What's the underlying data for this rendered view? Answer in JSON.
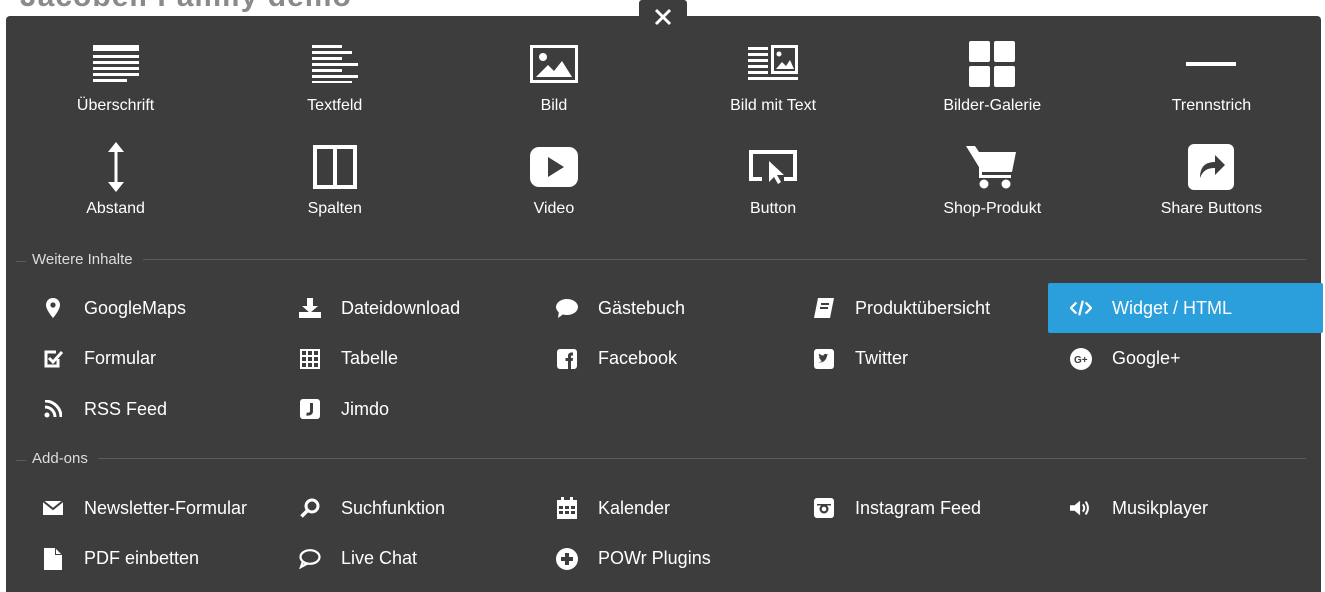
{
  "page": {
    "heading": "Jacobell Family demo"
  },
  "close": {
    "icon": "close-icon"
  },
  "tiles": [
    {
      "label": "Überschrift",
      "icon": "heading-icon"
    },
    {
      "label": "Textfeld",
      "icon": "text-icon"
    },
    {
      "label": "Bild",
      "icon": "image-icon"
    },
    {
      "label": "Bild mit Text",
      "icon": "image-text-icon"
    },
    {
      "label": "Bilder-Galerie",
      "icon": "gallery-icon"
    },
    {
      "label": "Trennstrich",
      "icon": "divider-icon"
    },
    {
      "label": "Abstand",
      "icon": "spacing-icon"
    },
    {
      "label": "Spalten",
      "icon": "columns-icon"
    },
    {
      "label": "Video",
      "icon": "video-icon"
    },
    {
      "label": "Button",
      "icon": "button-icon"
    },
    {
      "label": "Shop-Produkt",
      "icon": "cart-icon"
    },
    {
      "label": "Share Buttons",
      "icon": "share-icon"
    }
  ],
  "weitere": {
    "title": "Weitere Inhalte",
    "items": [
      {
        "label": "GoogleMaps",
        "icon": "map-pin-icon"
      },
      {
        "label": "Dateidownload",
        "icon": "download-icon"
      },
      {
        "label": "Gästebuch",
        "icon": "comment-icon"
      },
      {
        "label": "Produktübersicht",
        "icon": "product-list-icon"
      },
      {
        "label": "Widget / HTML",
        "icon": "code-icon",
        "active": true
      },
      {
        "label": "Formular",
        "icon": "checkbox-icon"
      },
      {
        "label": "Tabelle",
        "icon": "table-icon"
      },
      {
        "label": "Facebook",
        "icon": "facebook-icon"
      },
      {
        "label": "Twitter",
        "icon": "twitter-icon"
      },
      {
        "label": "Google+",
        "icon": "google-plus-icon"
      },
      {
        "label": "RSS Feed",
        "icon": "rss-icon"
      },
      {
        "label": "Jimdo",
        "icon": "jimdo-icon"
      }
    ]
  },
  "addons": {
    "title": "Add-ons",
    "items": [
      {
        "label": "Newsletter-Formular",
        "icon": "envelope-icon"
      },
      {
        "label": "Suchfunktion",
        "icon": "search-icon"
      },
      {
        "label": "Kalender",
        "icon": "calendar-icon"
      },
      {
        "label": "Instagram Feed",
        "icon": "instagram-icon"
      },
      {
        "label": "Musikplayer",
        "icon": "speaker-icon"
      },
      {
        "label": "PDF einbetten",
        "icon": "pdf-icon"
      },
      {
        "label": "Live Chat",
        "icon": "chat-icon"
      },
      {
        "label": "POWr Plugins",
        "icon": "plus-circle-icon"
      }
    ]
  },
  "colors": {
    "panel": "#3d3d3d",
    "active": "#2a9fdb",
    "text": "#ffffff"
  }
}
